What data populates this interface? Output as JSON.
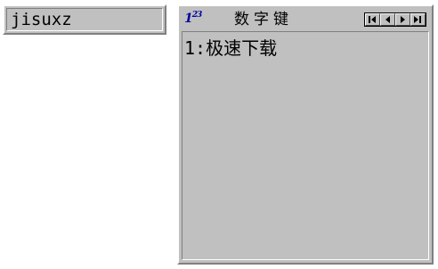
{
  "composition": {
    "text": "jisuxz"
  },
  "candidate_window": {
    "mode_icon": {
      "name": "number-mode-icon",
      "main": "1",
      "sup": "23"
    },
    "title": "数字键",
    "nav_buttons": [
      {
        "name": "first-page-icon"
      },
      {
        "name": "previous-page-icon"
      },
      {
        "name": "next-page-icon"
      },
      {
        "name": "last-page-icon"
      }
    ],
    "candidates": [
      {
        "label": "1:极速下载"
      }
    ]
  }
}
